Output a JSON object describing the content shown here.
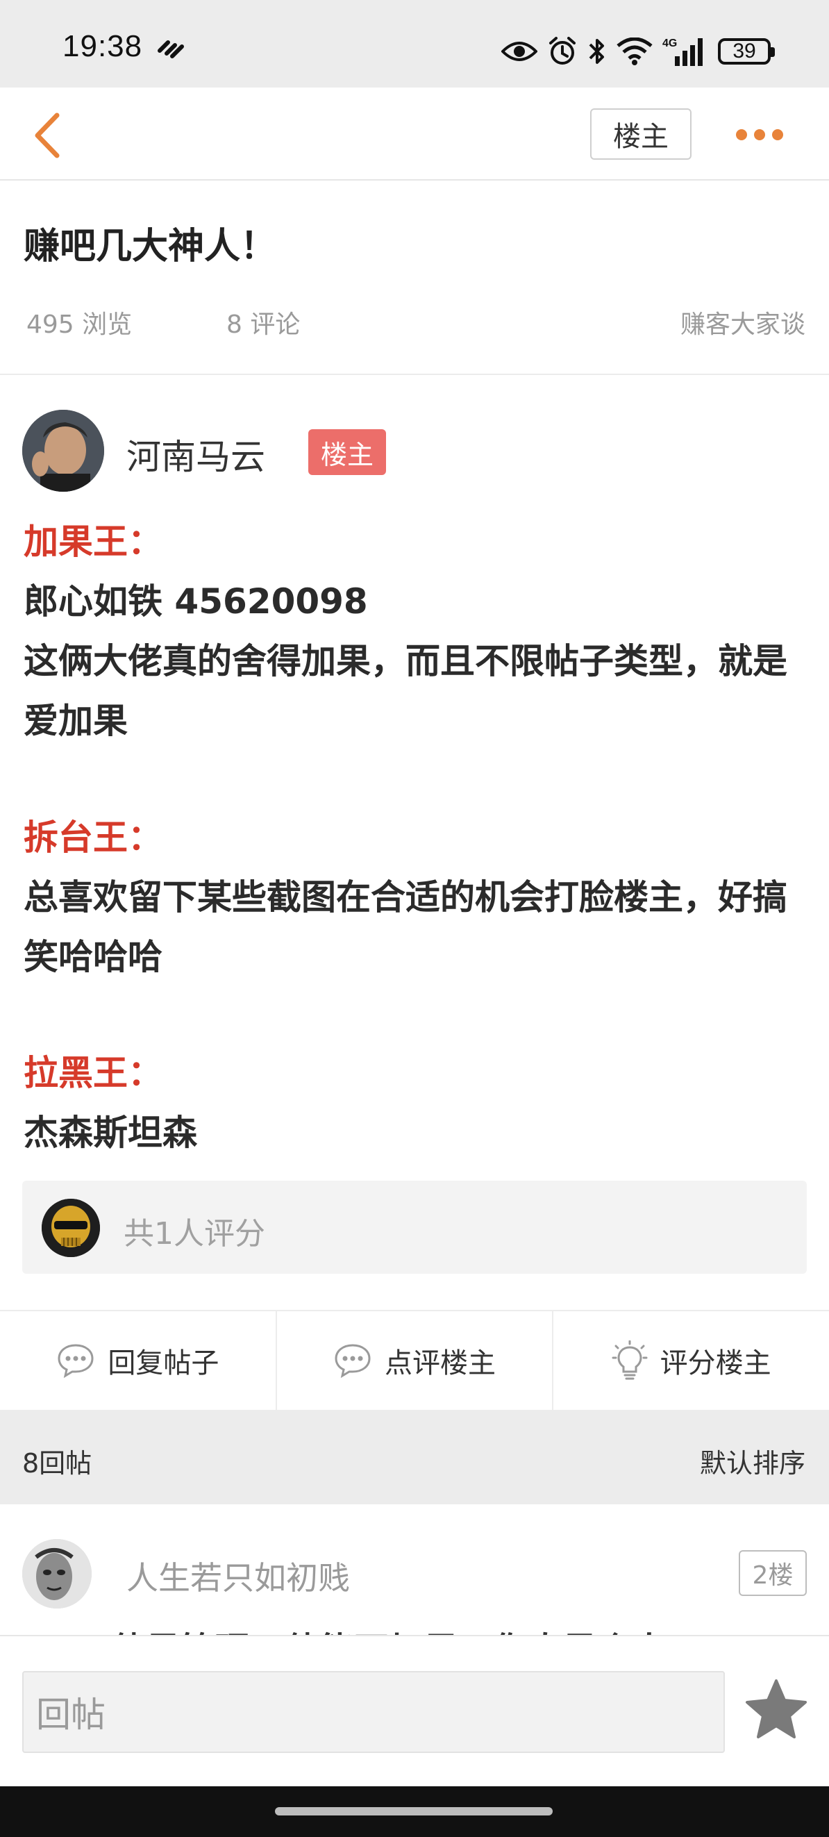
{
  "status_bar": {
    "time": "19:38",
    "battery": "39",
    "network": "4G"
  },
  "header": {
    "louzhu_button": "楼主"
  },
  "post": {
    "title": "赚吧几大神人！",
    "views": "495 浏览",
    "comments": "8 评论",
    "category": "赚客大家谈",
    "author": {
      "name": "河南马云",
      "badge": "楼主"
    },
    "content": [
      {
        "heading": "加果王：",
        "lines": [
          "郎心如铁  45620098",
          "这俩大佬真的舍得加果，而且不限帖子类型，就是爱加果"
        ]
      },
      {
        "heading": "拆台王：",
        "lines": [
          "总喜欢留下某些截图在合适的机会打脸楼主，好搞笑哈哈哈"
        ]
      },
      {
        "heading": "拉黑王：",
        "lines": [
          "杰森斯坦森"
        ]
      }
    ],
    "rating_summary": "共1人评分"
  },
  "actions": {
    "reply": "回复帖子",
    "comment": "点评楼主",
    "rate": "评分楼主"
  },
  "replies": {
    "count_label": "8回帖",
    "sort_label": "默认排序",
    "items": [
      {
        "name": "人生若只如初贱",
        "floor": "2楼",
        "peek": "他是管理，他能不加果，你真是个人"
      }
    ]
  },
  "bottom": {
    "input_placeholder": "回帖"
  },
  "colors": {
    "accent_orange": "#e8833a",
    "heading_red": "#d63a2a",
    "badge_red": "#ec6e6a"
  },
  "icons": {
    "back": "chevron-left-icon",
    "more": "more-dots-icon",
    "reply": "chat-bubble-icon",
    "comment": "chat-bubble-icon",
    "rate": "lightbulb-icon",
    "favorite": "star-icon"
  }
}
